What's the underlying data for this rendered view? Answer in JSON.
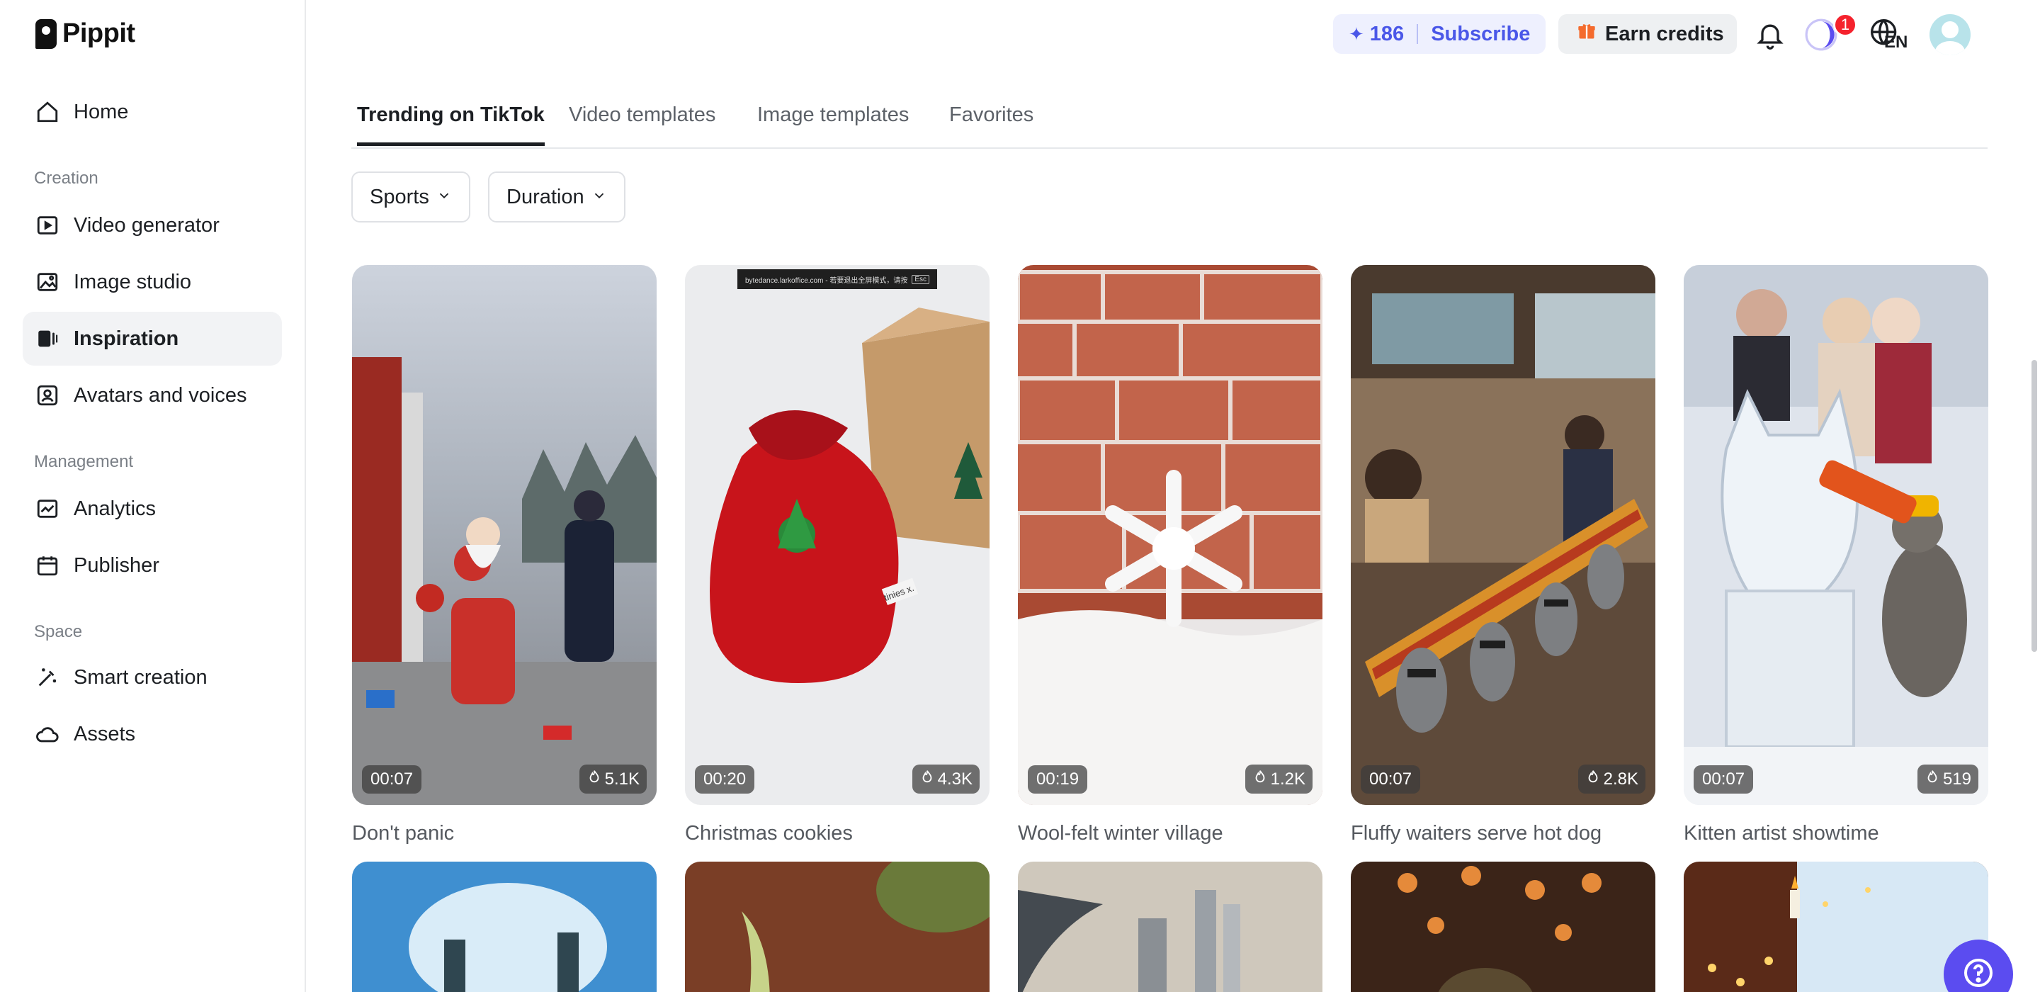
{
  "brand": {
    "name": "Pippit"
  },
  "sidebar": {
    "items": [
      {
        "label": "Home",
        "icon": "home-icon"
      },
      {
        "label": "Video generator",
        "icon": "video-generator-icon"
      },
      {
        "label": "Image studio",
        "icon": "image-studio-icon"
      },
      {
        "label": "Inspiration",
        "icon": "inspiration-icon",
        "active": true
      },
      {
        "label": "Avatars and voices",
        "icon": "avatar-icon"
      },
      {
        "label": "Analytics",
        "icon": "analytics-icon"
      },
      {
        "label": "Publisher",
        "icon": "calendar-icon"
      },
      {
        "label": "Smart creation",
        "icon": "magic-wand-icon"
      },
      {
        "label": "Assets",
        "icon": "cloud-icon"
      }
    ],
    "sections": {
      "creation": "Creation",
      "management": "Management",
      "space": "Space"
    }
  },
  "topbar": {
    "credits": "186",
    "subscribe": "Subscribe",
    "earn_credits": "Earn credits",
    "notification_count": "1",
    "language": "EN"
  },
  "tabs": [
    {
      "label": "Trending on TikTok",
      "active": true
    },
    {
      "label": "Video templates"
    },
    {
      "label": "Image templates"
    },
    {
      "label": "Favorites"
    }
  ],
  "filters": {
    "sports": "Sports",
    "duration": "Duration"
  },
  "cards": [
    {
      "title": "Don't panic",
      "duration": "00:07",
      "views": "5.1K"
    },
    {
      "title": "Christmas cookies",
      "duration": "00:20",
      "views": "4.3K"
    },
    {
      "title": "Wool-felt winter village",
      "duration": "00:19",
      "views": "1.2K"
    },
    {
      "title": "Fluffy waiters serve hot dog",
      "duration": "00:07",
      "views": "2.8K"
    },
    {
      "title": "Kitten artist showtime",
      "duration": "00:07",
      "views": "519"
    }
  ],
  "thumbnail_overlay": {
    "watermark": "bytedance.larkoffice.com - 若要退出全屏模式，请按",
    "esc": "Esc",
    "brand_tag": "tinies x."
  },
  "colors": {
    "accent": "#4a57e8",
    "help": "#5b4cf0",
    "badge": "#f5222d"
  }
}
